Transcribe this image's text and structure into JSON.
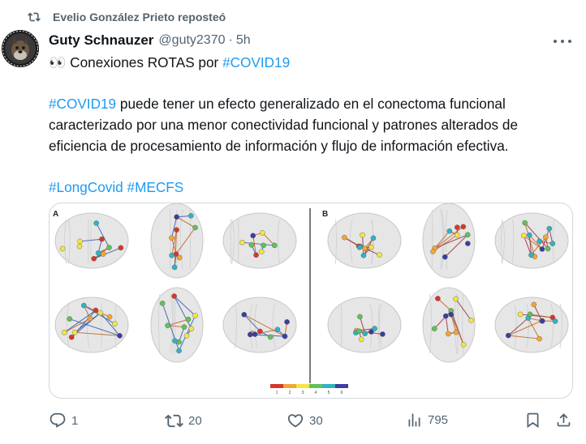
{
  "repost": {
    "text": "Evelio González Prieto reposteó",
    "icon": "repost-icon"
  },
  "post": {
    "author_name": "Guty Schnauzer",
    "author_handle": "@guty2370",
    "separator": "·",
    "time": "5h",
    "line1_emoji": "👀",
    "line1_text": " Conexiones ROTAS por ",
    "line1_hashtag": "#COVID19",
    "para2_hashtag": "#COVID19",
    "para2_text": " puede tener un efecto generalizado en el conectoma funcional caracterizado por una menor conectividad funcional y patrones alterados de eficiencia de procesamiento de información y flujo de información efectiva.",
    "tag1": "#LongCovid",
    "tag2": "#MECFS"
  },
  "figure": {
    "panel_a": "A",
    "panel_b": "B",
    "scale_labels": [
      "1",
      "2",
      "3",
      "4",
      "5",
      "6"
    ],
    "scale_colors": [
      "#d7372b",
      "#f2a634",
      "#f2e640",
      "#5fc15a",
      "#2fb3c4",
      "#3a3fa0"
    ]
  },
  "actions": {
    "reply_count": "1",
    "repost_count": "20",
    "like_count": "30",
    "views_count": "795"
  },
  "colors": {
    "accent": "#1d9bf0",
    "muted": "#536471",
    "text": "#0f1419"
  }
}
